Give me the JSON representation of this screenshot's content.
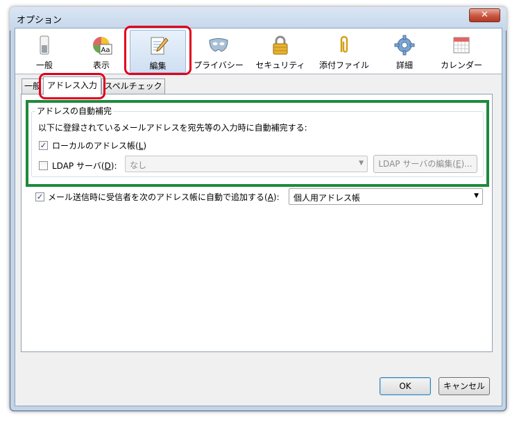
{
  "window": {
    "title": "オプション",
    "close_glyph": "✕"
  },
  "toolbar": [
    {
      "label": "一般",
      "icon": "switch-icon"
    },
    {
      "label": "表示",
      "icon": "font-display-icon"
    },
    {
      "label": "編集",
      "icon": "notepad-pencil-icon"
    },
    {
      "label": "プライバシー",
      "icon": "mask-icon"
    },
    {
      "label": "セキュリティ",
      "icon": "padlock-icon"
    },
    {
      "label": "添付ファイル",
      "icon": "paperclip-icon"
    },
    {
      "label": "詳細",
      "icon": "gear-icon"
    },
    {
      "label": "カレンダー",
      "icon": "calendar-icon"
    }
  ],
  "subtabs": [
    "一般",
    "アドレス入力",
    "スペルチェック"
  ],
  "group": {
    "legend": "アドレスの自動補完",
    "description": "以下に登録されているメールアドレスを宛先等の入力時に自動補完する:",
    "local_book": {
      "label": "ローカルのアドレス帳(",
      "key": "L",
      "close": ")",
      "checked": true
    },
    "ldap": {
      "label": "LDAP サーバ(",
      "key": "D",
      "close": "):",
      "checked": false
    },
    "ldap_select": "なし",
    "ldap_edit_button": {
      "label": "LDAP サーバの編集(",
      "key": "E",
      "close": ")..."
    }
  },
  "auto_add": {
    "label": "メール送信時に受信者を次のアドレス帳に自動で追加する(",
    "key": "A",
    "close": "):",
    "checked": true,
    "select": "個人用アドレス帳"
  },
  "buttons": {
    "ok": "OK",
    "cancel": "キャンセル"
  },
  "check_glyph": "✓",
  "arrow_glyph": "▼",
  "colors": {
    "highlight_red": "#e0001b",
    "highlight_green": "#1d8a3c"
  }
}
